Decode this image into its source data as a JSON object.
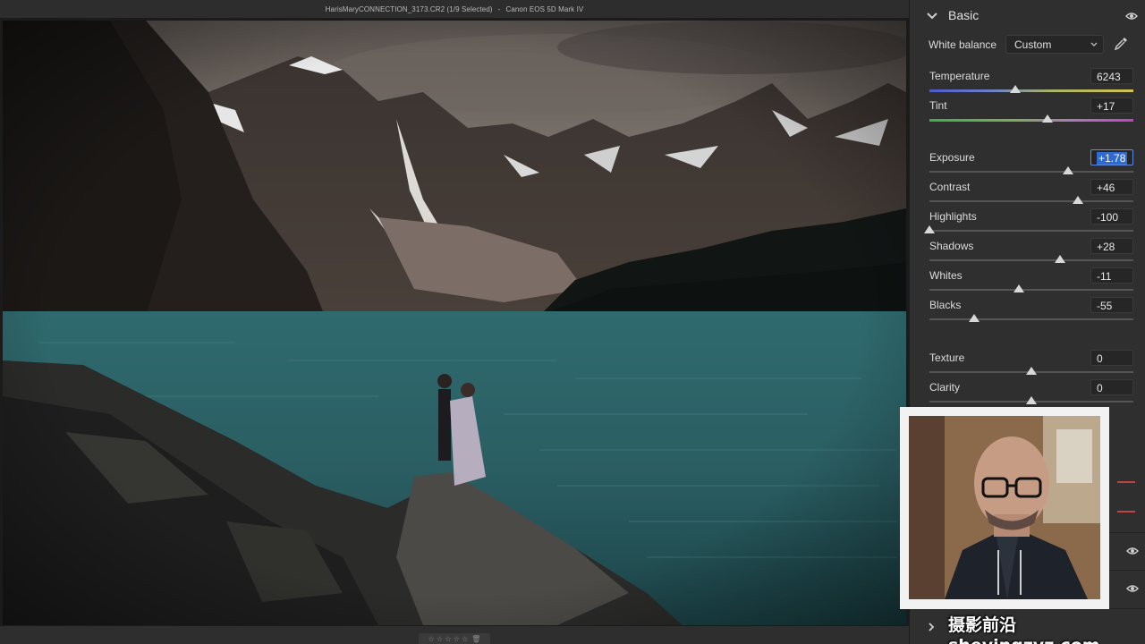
{
  "titlebar": {
    "filename": "HarisMaryCONNECTION_3173.CR2 (1/9 Selected)",
    "separator": "-",
    "camera": "Canon EOS 5D Mark IV"
  },
  "rating": {
    "stars": "☆ ☆ ☆ ☆ ☆",
    "trash": "🗑"
  },
  "panel": {
    "title": "Basic",
    "white_balance": {
      "label": "White balance",
      "value": "Custom"
    },
    "sliders": [
      {
        "label": "Temperature",
        "value": "6243",
        "level": 0.42
      },
      {
        "label": "Tint",
        "value": "+17",
        "level": 0.58
      },
      {
        "label": "Exposure",
        "value": "+1.78",
        "level": 0.68
      },
      {
        "label": "Contrast",
        "value": "+46",
        "level": 0.73
      },
      {
        "label": "Highlights",
        "value": "-100",
        "level": 0.0
      },
      {
        "label": "Shadows",
        "value": "+28",
        "level": 0.64
      },
      {
        "label": "Whites",
        "value": "-11",
        "level": 0.44
      },
      {
        "label": "Blacks",
        "value": "-55",
        "level": 0.22
      },
      {
        "label": "Texture",
        "value": "0",
        "level": 0.5
      },
      {
        "label": "Clarity",
        "value": "0",
        "level": 0.5
      }
    ]
  },
  "icons": {
    "collapse": "chevron-down-icon",
    "expand": "chevron-right-icon",
    "visibility": "eye-icon",
    "picker": "eyedropper-icon"
  },
  "watermark": "摄影前沿sheyingzyz.com"
}
